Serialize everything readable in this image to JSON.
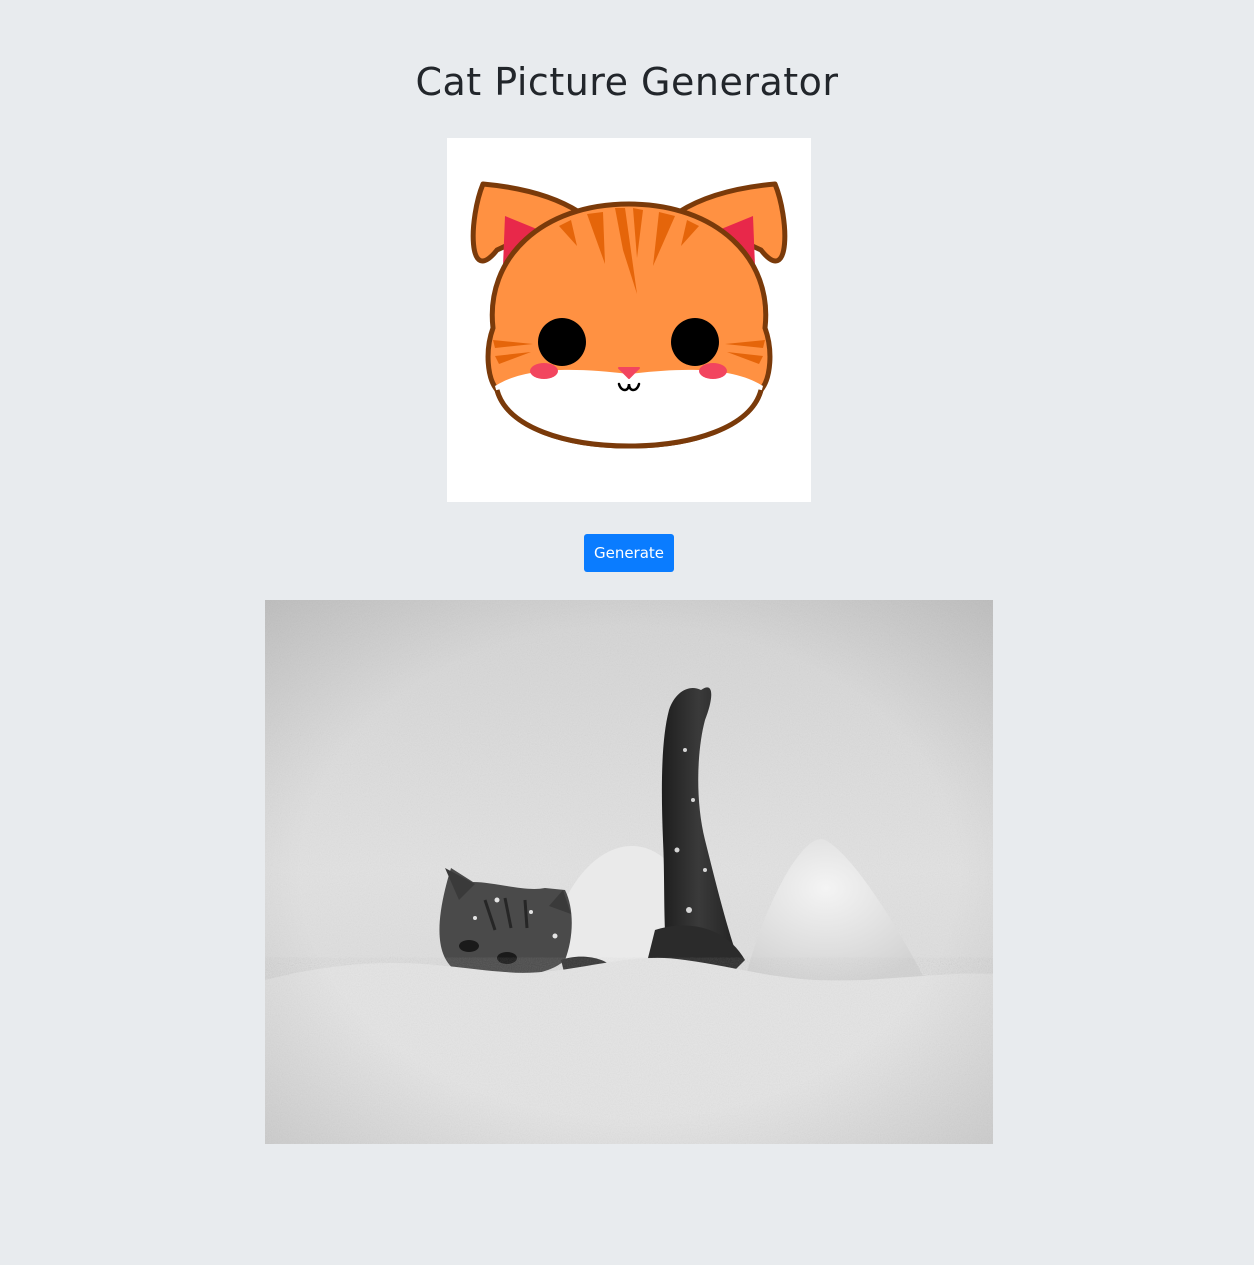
{
  "header": {
    "title": "Cat Picture Generator"
  },
  "controls": {
    "generate_label": "Generate"
  },
  "colors": {
    "page_background": "#e8ebee",
    "button_primary": "#0a7cff",
    "cat_orange": "#ff9142",
    "cat_stripes": "#e5650a",
    "cat_outline": "#7a3a0a",
    "ear_inner": "#e8284a",
    "cheek": "#f2455f"
  },
  "images": {
    "logo_icon": "cartoon-cat-face-icon",
    "generated_photo": "kitten-in-snow-photo"
  }
}
